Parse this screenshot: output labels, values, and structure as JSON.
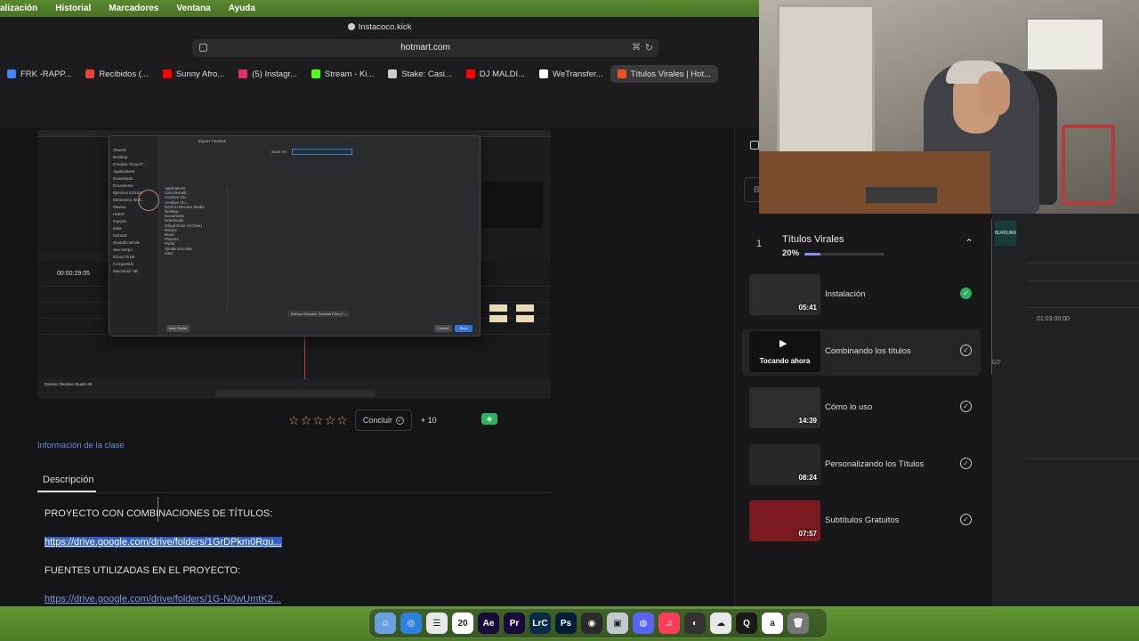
{
  "menubar": {
    "items": [
      "alización",
      "Historial",
      "Marcadores",
      "Ventana",
      "Ayuda"
    ]
  },
  "browser": {
    "window_title": "Instacoco.kick",
    "url": "hotmart.com",
    "bookmarks": [
      {
        "label": "FRK -RAPP...",
        "icon": "google-icon",
        "color": "#4285f4"
      },
      {
        "label": "Recibidos (...",
        "icon": "gmail-icon",
        "color": "#ea4335"
      },
      {
        "label": "Sunny Afro...",
        "icon": "youtube-icon",
        "color": "#ff0000"
      },
      {
        "label": "(5) Instagr...",
        "icon": "instagram-icon",
        "color": "#e1306c"
      },
      {
        "label": "Stream - Ki...",
        "icon": "kick-icon",
        "color": "#53fc18"
      },
      {
        "label": "Stake: Casi...",
        "icon": "stake-icon",
        "color": "#cccccc"
      },
      {
        "label": "DJ MALDI...",
        "icon": "youtube-icon",
        "color": "#ff0000"
      },
      {
        "label": "WeTransfer...",
        "icon": "wetransfer-icon",
        "color": "#ffffff"
      },
      {
        "label": "Títulos Virales | Hot...",
        "icon": "hotmart-icon",
        "color": "#f04e23",
        "active": true
      }
    ]
  },
  "video": {
    "timecode": "00:00:29:05",
    "dialog_title": "Export Timeline",
    "save_as_label": "Save As:",
    "sidebar_items": [
      "Shared",
      "Desktop",
      "Creative Cloud F...",
      "Applications",
      "Downloads",
      "Documents",
      "Ejercicio Edición",
      "Elementos de E...",
      "Movies",
      "Hansh",
      "Imports",
      "Italia",
      "hotmart",
      "SoundControls",
      "Seu tempo",
      "iCloud Drive",
      "Compartido",
      "Macintosh HD"
    ],
    "files": [
      "Applications",
      "com.elemulti...",
      "Creative Clo...",
      "Creative Clo...",
      "DaVinci Resolve Media",
      "Desktop",
      "Documents",
      "Downloads",
      "iCloud Drive (Archive)",
      "Movies",
      "Music",
      "Pictures",
      "Public",
      "Shutter Encoder",
      "Sites"
    ],
    "format": "DaVinci Resolve Timeline Files (*...",
    "new_folder": "New Folder",
    "cancel": "Cancel",
    "save": "Save",
    "brand": "DaVinci Resolve Studio 20"
  },
  "rating": {
    "stars": 5,
    "filled": 0
  },
  "concluir_label": "Concluir",
  "plus_label": "+ 10",
  "class_info_label": "Información de la clase",
  "tab_label": "Descripción",
  "description": {
    "heading1": "PROYECTO CON COMBINACIONES DE TÍTULOS:",
    "link1": "https://drive.google.com/drive/folders/1GrDPkm0Rgu...",
    "heading2": "FUENTES UTILIZADAS EN EL PROYECTO:",
    "link2": "https://drive.google.com/drive/folders/1G-N0wUmtK2..."
  },
  "module": {
    "number": "1",
    "title": "Títulos Virales",
    "progress_label": "20%",
    "progress": 0.2
  },
  "lessons": [
    {
      "title": "Instalación",
      "duration": "05:41",
      "status": "done",
      "thumb_bg": "#2a2c30"
    },
    {
      "title": "Combinando los títulos",
      "duration": "",
      "now_label": "Tocando ahora",
      "status": "check",
      "active": true,
      "thumb_bg": "#111114"
    },
    {
      "title": "Cómo lo uso",
      "duration": "14:39",
      "status": "check",
      "thumb_bg": "#2b2d30"
    },
    {
      "title": "Personalizando los Títulos",
      "duration": "08:24",
      "status": "check",
      "thumb_bg": "#25272b"
    },
    {
      "title": "Subtítulos Gratuitos",
      "duration": "07:57",
      "status": "check",
      "thumb_bg": "#7a1a1e"
    }
  ],
  "strip": {
    "timecode": "01:03:00:00",
    "edit_label": "DIT",
    "logo_text": "BLRDUMX"
  },
  "dock": [
    "finder-icon",
    "safari-icon",
    "notes-icon",
    "20",
    "Ae",
    "Pr",
    "LrC",
    "Ps",
    "resolve-icon",
    "preview-icon",
    "discord-icon",
    "music-icon",
    "screenrec-icon",
    "cloud-icon",
    "quicktime-icon",
    "a",
    "trash-icon"
  ]
}
